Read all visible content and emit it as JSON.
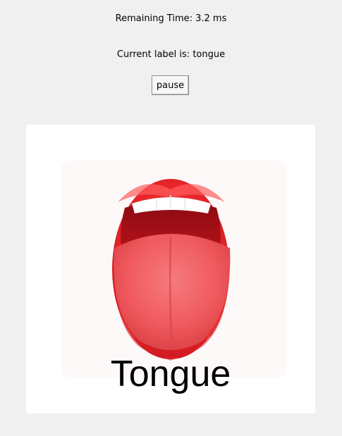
{
  "status": {
    "remaining_time": "Remaining Time: 3.2 ms",
    "current_label": "Current label is: tongue"
  },
  "controls": {
    "pause_label": "pause"
  },
  "image": {
    "caption": "Tongue",
    "icon": "open-mouth-tongue",
    "colors": {
      "lips": "#e8262a",
      "tongue": "#ef5a5e",
      "mouth_interior": "#b3121a",
      "teeth": "#ffffff",
      "background": "#ffffff"
    }
  }
}
